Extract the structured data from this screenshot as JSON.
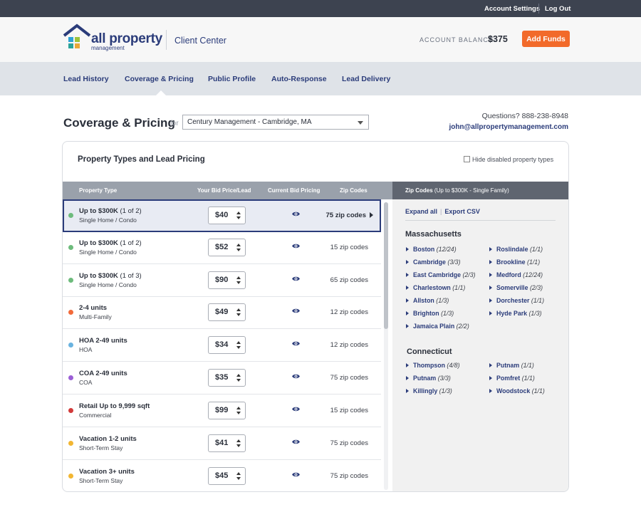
{
  "topbar": {
    "account_settings": "Account Settings",
    "log_out": "Log Out"
  },
  "header": {
    "brand": "all property",
    "brand_sub": "management",
    "client_center": "Client Center",
    "balance_label": "ACCOUNT BALANCE:",
    "balance_value": "$375",
    "add_funds": "Add Funds"
  },
  "nav": {
    "items": [
      {
        "label": "Lead History"
      },
      {
        "label": "Coverage & Pricing",
        "active": true
      },
      {
        "label": "Public Profile"
      },
      {
        "label": "Auto-Response"
      },
      {
        "label": "Lead Delivery"
      }
    ]
  },
  "page": {
    "title": "Coverage & Pricing",
    "for_label": "for",
    "selected_account": "Century Management - Cambridge, MA",
    "questions": "Questions? 888-238-8948",
    "email": "john@allpropertymanagement.com"
  },
  "panel": {
    "title": "Property Types and Lead Pricing",
    "hide_disabled": "Hide disabled property types",
    "columns": {
      "type": "Property Type",
      "bid": "Your Bid Price/Lead",
      "current": "Current Bid Pricing",
      "zips": "Zip Codes"
    },
    "rows": [
      {
        "name": "Up to $300K",
        "count": "(1 of 2)",
        "sub": "Single Home / Condo",
        "bid": "$40",
        "zips": "75 zip codes",
        "dot": "#6dbb7c",
        "selected": true
      },
      {
        "name": "Up to $300K",
        "count": "(1 of 2)",
        "sub": "Single Home / Condo",
        "bid": "$52",
        "zips": "15 zip codes",
        "dot": "#6dbb7c"
      },
      {
        "name": "Up to $300K",
        "count": "(1 of 3)",
        "sub": "Single Home / Condo",
        "bid": "$90",
        "zips": "65 zip codes",
        "dot": "#6dbb7c"
      },
      {
        "name": "2-4 units",
        "count": "",
        "sub": "Multi-Family",
        "bid": "$49",
        "zips": "12 zip codes",
        "dot": "#f26a3a"
      },
      {
        "name": "HOA 2-49 units",
        "count": "",
        "sub": "HOA",
        "bid": "$34",
        "zips": "12 zip codes",
        "dot": "#6ab3e0"
      },
      {
        "name": "COA 2-49 units",
        "count": "",
        "sub": "COA",
        "bid": "$35",
        "zips": "75 zip codes",
        "dot": "#9b5fd6"
      },
      {
        "name": "Retail Up to 9,999 sqft",
        "count": "",
        "sub": "Commercial",
        "bid": "$99",
        "zips": "15 zip codes",
        "dot": "#d23a3a"
      },
      {
        "name": "Vacation 1-2 units",
        "count": "",
        "sub": "Short-Term Stay",
        "bid": "$41",
        "zips": "75 zip codes",
        "dot": "#f2b632"
      },
      {
        "name": "Vacation 3+ units",
        "count": "",
        "sub": "Short-Term Stay",
        "bid": "$45",
        "zips": "75 zip codes",
        "dot": "#f2b632"
      }
    ]
  },
  "zip_panel": {
    "header_bold": "Zip Codes",
    "header_rest": "(Up to $300K - Single Family)",
    "expand_all": "Expand all",
    "export_csv": "Export CSV",
    "states": [
      {
        "name": "Massachusetts",
        "cities": [
          {
            "name": "Boston",
            "count": "(12/24)"
          },
          {
            "name": "Roslindale",
            "count": "(1/1)"
          },
          {
            "name": "Cambridge",
            "count": "(3/3)"
          },
          {
            "name": "Brookline",
            "count": "(1/1)"
          },
          {
            "name": "East Cambridge",
            "count": "(2/3)"
          },
          {
            "name": "Medford",
            "count": "(12/24)"
          },
          {
            "name": "Charlestown",
            "count": "(1/1)"
          },
          {
            "name": "Somerville",
            "count": "(2/3)"
          },
          {
            "name": "Allston",
            "count": "(1/3)"
          },
          {
            "name": "Dorchester",
            "count": "(1/1)"
          },
          {
            "name": "Brighton",
            "count": "(1/3)"
          },
          {
            "name": "Hyde Park",
            "count": "(1/3)"
          },
          {
            "name": "Jamaica Plain",
            "count": "(2/2)"
          }
        ]
      },
      {
        "name": "Connecticut",
        "cities": [
          {
            "name": "Thompson",
            "count": "(4/8)"
          },
          {
            "name": "Putnam",
            "count": "(1/1)"
          },
          {
            "name": "Putnam",
            "count": "(3/3)"
          },
          {
            "name": "Pomfret",
            "count": "(1/1)"
          },
          {
            "name": "Killingly",
            "count": "(1/3)"
          },
          {
            "name": "Woodstock",
            "count": "(1/1)"
          }
        ]
      }
    ]
  }
}
